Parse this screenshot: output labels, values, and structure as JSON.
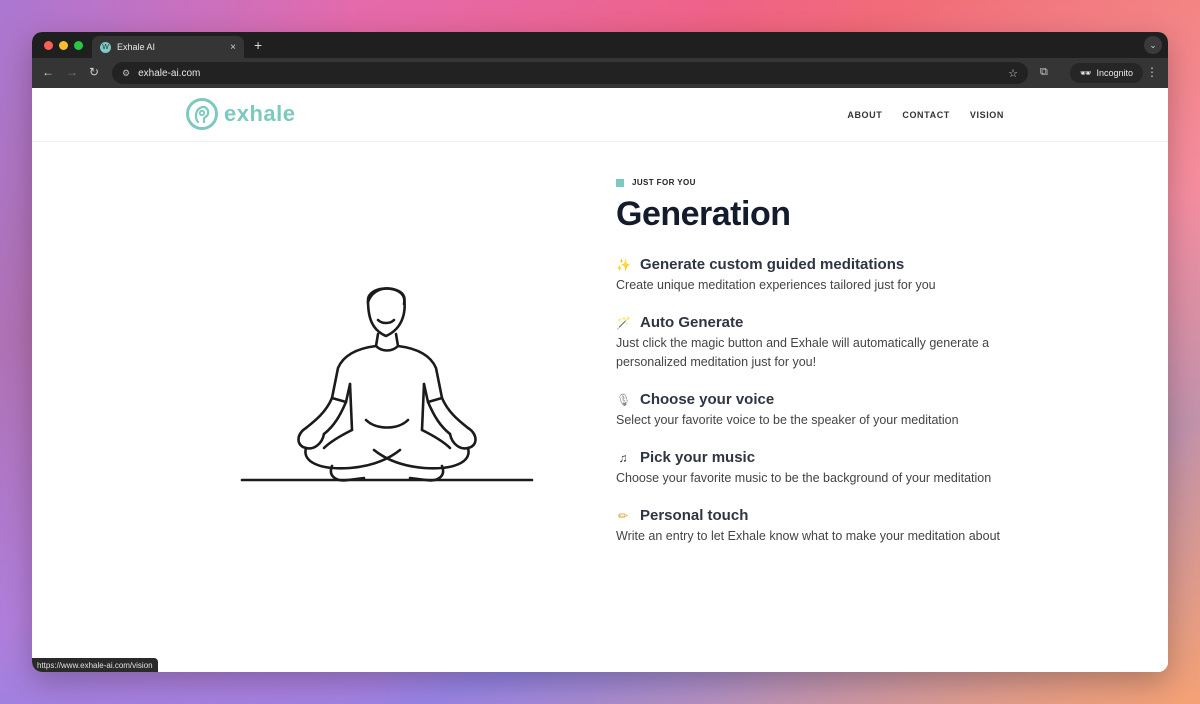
{
  "browser": {
    "tab_title": "Exhale AI",
    "tab_close": "×",
    "new_tab": "+",
    "url": "exhale-ai.com",
    "incognito_label": "Incognito",
    "status_url": "https://www.exhale-ai.com/vision"
  },
  "header": {
    "logo_text": "exhale",
    "nav": [
      "ABOUT",
      "CONTACT",
      "VISION"
    ]
  },
  "section": {
    "eyebrow": "JUST FOR YOU",
    "title": "Generation",
    "features": [
      {
        "icon": "✨",
        "icon_name": "sparkles-icon",
        "title": "Generate custom guided meditations",
        "desc": "Create unique meditation experiences tailored just for you"
      },
      {
        "icon": "🪄",
        "icon_name": "magic-wand-icon",
        "title": "Auto Generate",
        "desc": "Just click the magic button and Exhale will automatically generate a personalized meditation just for you!"
      },
      {
        "icon": "🎙",
        "icon_name": "microphone-icon",
        "title": "Choose your voice",
        "desc": "Select your favorite voice to be the speaker of your meditation"
      },
      {
        "icon": "♫",
        "icon_name": "music-note-icon",
        "title": "Pick your music",
        "desc": "Choose your favorite music to be the background of your meditation"
      },
      {
        "icon": "✏",
        "icon_name": "pencil-icon",
        "title": "Personal touch",
        "desc": "Write an entry to let Exhale know what to make your meditation about"
      }
    ]
  },
  "colors": {
    "accent": "#7ccabf",
    "title": "#141b2d",
    "text": "#444444"
  }
}
